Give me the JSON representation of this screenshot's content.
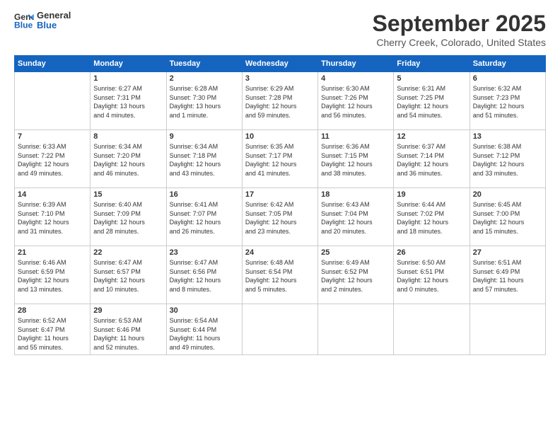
{
  "logo": {
    "line1": "General",
    "line2": "Blue"
  },
  "title": "September 2025",
  "subtitle": "Cherry Creek, Colorado, United States",
  "weekdays": [
    "Sunday",
    "Monday",
    "Tuesday",
    "Wednesday",
    "Thursday",
    "Friday",
    "Saturday"
  ],
  "weeks": [
    [
      {
        "day": "",
        "info": ""
      },
      {
        "day": "1",
        "info": "Sunrise: 6:27 AM\nSunset: 7:31 PM\nDaylight: 13 hours\nand 4 minutes."
      },
      {
        "day": "2",
        "info": "Sunrise: 6:28 AM\nSunset: 7:30 PM\nDaylight: 13 hours\nand 1 minute."
      },
      {
        "day": "3",
        "info": "Sunrise: 6:29 AM\nSunset: 7:28 PM\nDaylight: 12 hours\nand 59 minutes."
      },
      {
        "day": "4",
        "info": "Sunrise: 6:30 AM\nSunset: 7:26 PM\nDaylight: 12 hours\nand 56 minutes."
      },
      {
        "day": "5",
        "info": "Sunrise: 6:31 AM\nSunset: 7:25 PM\nDaylight: 12 hours\nand 54 minutes."
      },
      {
        "day": "6",
        "info": "Sunrise: 6:32 AM\nSunset: 7:23 PM\nDaylight: 12 hours\nand 51 minutes."
      }
    ],
    [
      {
        "day": "7",
        "info": "Sunrise: 6:33 AM\nSunset: 7:22 PM\nDaylight: 12 hours\nand 49 minutes."
      },
      {
        "day": "8",
        "info": "Sunrise: 6:34 AM\nSunset: 7:20 PM\nDaylight: 12 hours\nand 46 minutes."
      },
      {
        "day": "9",
        "info": "Sunrise: 6:34 AM\nSunset: 7:18 PM\nDaylight: 12 hours\nand 43 minutes."
      },
      {
        "day": "10",
        "info": "Sunrise: 6:35 AM\nSunset: 7:17 PM\nDaylight: 12 hours\nand 41 minutes."
      },
      {
        "day": "11",
        "info": "Sunrise: 6:36 AM\nSunset: 7:15 PM\nDaylight: 12 hours\nand 38 minutes."
      },
      {
        "day": "12",
        "info": "Sunrise: 6:37 AM\nSunset: 7:14 PM\nDaylight: 12 hours\nand 36 minutes."
      },
      {
        "day": "13",
        "info": "Sunrise: 6:38 AM\nSunset: 7:12 PM\nDaylight: 12 hours\nand 33 minutes."
      }
    ],
    [
      {
        "day": "14",
        "info": "Sunrise: 6:39 AM\nSunset: 7:10 PM\nDaylight: 12 hours\nand 31 minutes."
      },
      {
        "day": "15",
        "info": "Sunrise: 6:40 AM\nSunset: 7:09 PM\nDaylight: 12 hours\nand 28 minutes."
      },
      {
        "day": "16",
        "info": "Sunrise: 6:41 AM\nSunset: 7:07 PM\nDaylight: 12 hours\nand 26 minutes."
      },
      {
        "day": "17",
        "info": "Sunrise: 6:42 AM\nSunset: 7:05 PM\nDaylight: 12 hours\nand 23 minutes."
      },
      {
        "day": "18",
        "info": "Sunrise: 6:43 AM\nSunset: 7:04 PM\nDaylight: 12 hours\nand 20 minutes."
      },
      {
        "day": "19",
        "info": "Sunrise: 6:44 AM\nSunset: 7:02 PM\nDaylight: 12 hours\nand 18 minutes."
      },
      {
        "day": "20",
        "info": "Sunrise: 6:45 AM\nSunset: 7:00 PM\nDaylight: 12 hours\nand 15 minutes."
      }
    ],
    [
      {
        "day": "21",
        "info": "Sunrise: 6:46 AM\nSunset: 6:59 PM\nDaylight: 12 hours\nand 13 minutes."
      },
      {
        "day": "22",
        "info": "Sunrise: 6:47 AM\nSunset: 6:57 PM\nDaylight: 12 hours\nand 10 minutes."
      },
      {
        "day": "23",
        "info": "Sunrise: 6:47 AM\nSunset: 6:56 PM\nDaylight: 12 hours\nand 8 minutes."
      },
      {
        "day": "24",
        "info": "Sunrise: 6:48 AM\nSunset: 6:54 PM\nDaylight: 12 hours\nand 5 minutes."
      },
      {
        "day": "25",
        "info": "Sunrise: 6:49 AM\nSunset: 6:52 PM\nDaylight: 12 hours\nand 2 minutes."
      },
      {
        "day": "26",
        "info": "Sunrise: 6:50 AM\nSunset: 6:51 PM\nDaylight: 12 hours\nand 0 minutes."
      },
      {
        "day": "27",
        "info": "Sunrise: 6:51 AM\nSunset: 6:49 PM\nDaylight: 11 hours\nand 57 minutes."
      }
    ],
    [
      {
        "day": "28",
        "info": "Sunrise: 6:52 AM\nSunset: 6:47 PM\nDaylight: 11 hours\nand 55 minutes."
      },
      {
        "day": "29",
        "info": "Sunrise: 6:53 AM\nSunset: 6:46 PM\nDaylight: 11 hours\nand 52 minutes."
      },
      {
        "day": "30",
        "info": "Sunrise: 6:54 AM\nSunset: 6:44 PM\nDaylight: 11 hours\nand 49 minutes."
      },
      {
        "day": "",
        "info": ""
      },
      {
        "day": "",
        "info": ""
      },
      {
        "day": "",
        "info": ""
      },
      {
        "day": "",
        "info": ""
      }
    ]
  ]
}
